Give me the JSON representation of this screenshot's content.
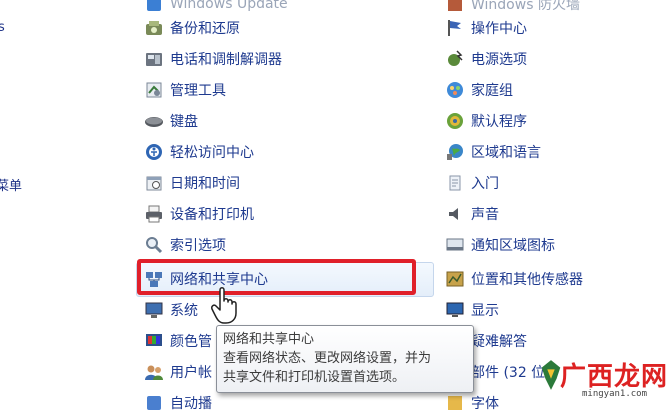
{
  "left_edge": {
    "item_a": "s",
    "item_b": "菜单"
  },
  "middle_column": {
    "cut_item": "Windows Update",
    "items": [
      {
        "label": "备份和还原",
        "icon": "backup-icon"
      },
      {
        "label": "电话和调制解调器",
        "icon": "phone-modem-icon"
      },
      {
        "label": "管理工具",
        "icon": "admin-tools-icon"
      },
      {
        "label": "键盘",
        "icon": "keyboard-icon"
      },
      {
        "label": "轻松访问中心",
        "icon": "ease-of-access-icon"
      },
      {
        "label": "日期和时间",
        "icon": "date-time-icon"
      },
      {
        "label": "设备和打印机",
        "icon": "printer-icon"
      },
      {
        "label": "索引选项",
        "icon": "indexing-icon"
      },
      {
        "label": "网络和共享中心",
        "icon": "network-icon"
      },
      {
        "label": "系统",
        "icon": "system-icon"
      },
      {
        "label": "颜色管",
        "icon": "color-management-icon"
      },
      {
        "label": "用户帐",
        "icon": "user-accounts-icon"
      },
      {
        "label": "自动播",
        "icon": "autoplay-icon"
      }
    ]
  },
  "right_column": {
    "cut_item": "Windows 防火墙",
    "items": [
      {
        "label": "操作中心",
        "icon": "action-center-flag-icon"
      },
      {
        "label": "电源选项",
        "icon": "power-options-icon"
      },
      {
        "label": "家庭组",
        "icon": "homegroup-icon"
      },
      {
        "label": "默认程序",
        "icon": "default-programs-icon"
      },
      {
        "label": "区域和语言",
        "icon": "region-language-icon"
      },
      {
        "label": "入门",
        "icon": "getting-started-icon"
      },
      {
        "label": "声音",
        "icon": "sound-icon"
      },
      {
        "label": "通知区域图标",
        "icon": "notification-area-icon"
      },
      {
        "label": "位置和其他传感器",
        "icon": "location-sensors-icon"
      },
      {
        "label": "显示",
        "icon": "display-icon"
      },
      {
        "label": "疑难解答",
        "icon": "troubleshooting-icon"
      },
      {
        "label": "字体",
        "icon": "fonts-icon"
      }
    ],
    "partial_item": "部件 (32 位",
    "partial_item_2": "字体"
  },
  "tooltip": {
    "title": "网络和共享中心",
    "line1": "查看网络状态、更改网络设置，并为",
    "line2": "共享文件和打印机设置首选项。"
  },
  "watermark": {
    "text": "广西龙网",
    "url": "mingyan1.com"
  },
  "colors": {
    "link": "#1e3a8f",
    "highlight_border": "#e0202a",
    "tooltip_border": "#8a8f98"
  }
}
